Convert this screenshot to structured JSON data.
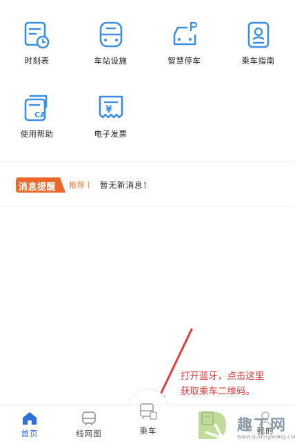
{
  "services": [
    {
      "label": "时刻表",
      "icon": "timetable-icon"
    },
    {
      "label": "车站设施",
      "icon": "station-facility-icon"
    },
    {
      "label": "智慧停车",
      "icon": "smart-parking-icon"
    },
    {
      "label": "乘车指南",
      "icon": "riding-guide-icon"
    },
    {
      "label": "使用帮助",
      "icon": "help-ca-icon"
    },
    {
      "label": "电子发票",
      "icon": "e-invoice-icon"
    }
  ],
  "message": {
    "badge": "消息提醒",
    "tag": "推荐丨",
    "text": "暂无新消息！"
  },
  "annotation": {
    "line1": "打开蓝牙，点击这里",
    "line2": "获取乘车二维码。"
  },
  "tabs": [
    {
      "label": "首页",
      "icon": "home-icon",
      "active": true
    },
    {
      "label": "线网图",
      "icon": "metro-map-icon"
    },
    {
      "label": "乘车",
      "icon": "ride-train-icon"
    },
    {
      "label": "",
      "icon": "ticket-icon"
    },
    {
      "label": "我的",
      "icon": "profile-icon"
    }
  ],
  "watermark": {
    "text": "趣丁网",
    "url": "www.qudingwang.com"
  },
  "colors": {
    "accent": "#3a8ee6",
    "badge_orange": "#f0672c",
    "annotation_red": "#e53a3a",
    "tab_active": "#2f6fdd"
  }
}
